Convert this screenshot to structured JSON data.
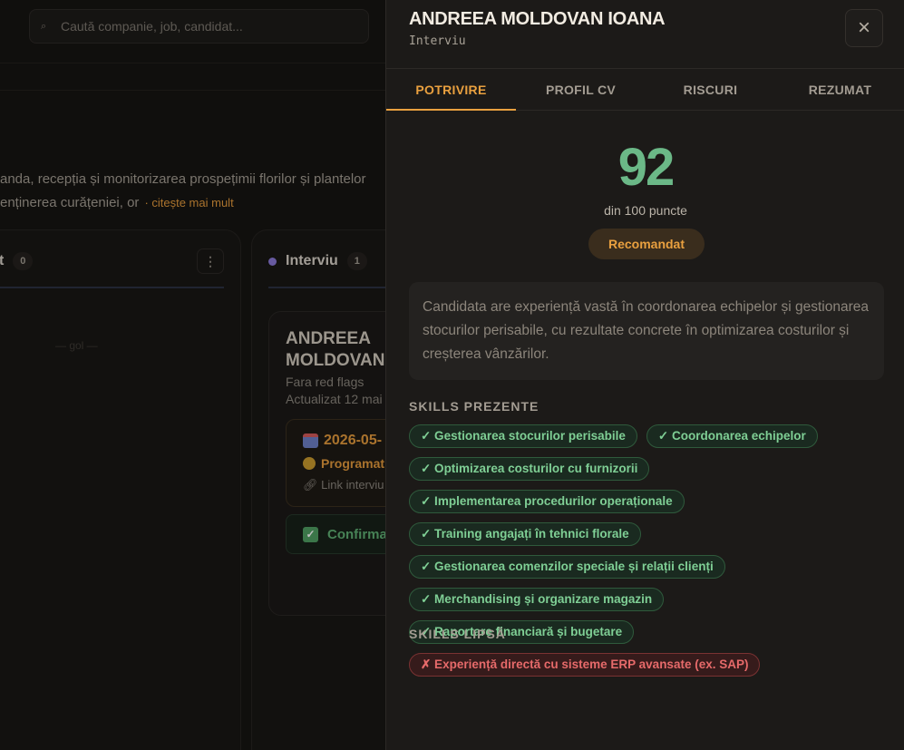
{
  "search": {
    "placeholder": "Caută companie, job, candidat..."
  },
  "job": {
    "description_line1": "anda, recepția și monitorizarea prospețimii florilor și plantelor",
    "description_line2": "enținerea curățeniei, or",
    "read_more": "· citește mai mult"
  },
  "columns": [
    {
      "name": "t",
      "count": "0",
      "empty_hint": "— gol —"
    },
    {
      "name": "Interviu",
      "count": "1",
      "status_color": "#8a78d6"
    }
  ],
  "card": {
    "name": "ANDREEA MOLDOVAN IOANA",
    "flags": "Fara red flags",
    "updated": "Actualizat 12 mai",
    "interview_date": "2026-05-",
    "interview_status": "Programat",
    "interview_link": "Link interviu",
    "confirm_label": "Confirmat"
  },
  "panel": {
    "candidate_name": "ANDREEA MOLDOVAN IOANA",
    "stage": "Interviu",
    "close_icon": "×",
    "tabs": [
      {
        "label": "POTRIVIRE",
        "active": true
      },
      {
        "label": "PROFIL CV",
        "active": false
      },
      {
        "label": "RISCURI",
        "active": false
      },
      {
        "label": "REZUMAT",
        "active": false
      }
    ],
    "score": "92",
    "score_caption": "din 100 puncte",
    "recommendation": "Recomandat",
    "summary": "Candidata are experiență vastă în coordonarea echipelor și gestionarea stocurilor perisabile, cu rezultate concrete în optimizarea costurilor și creșterea vânzărilor.",
    "skills_present_title": "SKILLS PREZENTE",
    "skills_present": [
      "✓ Gestionarea stocurilor perisabile",
      "✓ Coordonarea echipelor",
      "✓ Optimizarea costurilor cu furnizorii",
      "✓ Implementarea procedurilor operaționale",
      "✓ Training angajați în tehnici florale",
      "✓ Gestionarea comenzilor speciale și relații clienți",
      "✓ Merchandising și organizare magazin",
      "✓ Raportare financiară și bugetare"
    ],
    "skills_missing_title": "SKILLS LIPSĂ",
    "skills_missing": [
      "✗ Experiență directă cu sisteme ERP avansate (ex. SAP)"
    ]
  },
  "colors": {
    "accent": "#e9a03f",
    "score": "#6bb887",
    "skill_ok": "#7fcf95",
    "skill_missing": "#e66a6a"
  }
}
